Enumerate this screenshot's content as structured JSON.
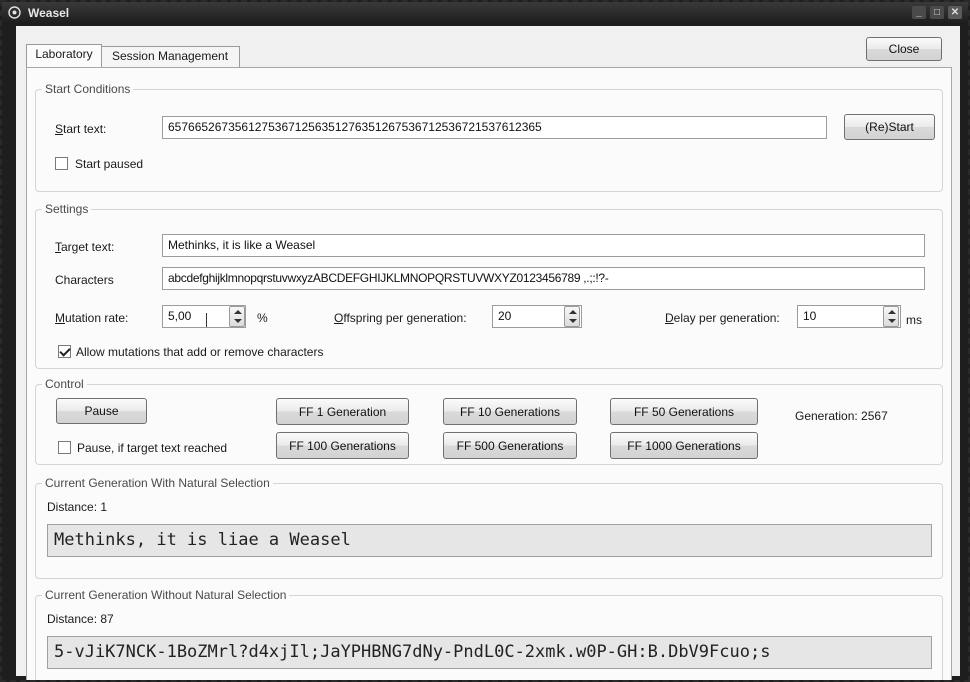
{
  "window": {
    "title": "Weasel",
    "close_label": "Close"
  },
  "tabs": [
    {
      "label": "Laboratory",
      "active": true
    },
    {
      "label": "Session Management",
      "active": false
    }
  ],
  "start_conditions": {
    "title": "Start Conditions",
    "start_text_label": "Start text:",
    "start_text_value": "65766526735612753671256351276351267536712536721537612365",
    "restart_label": "(Re)Start",
    "start_paused_label": "Start paused",
    "start_paused_checked": false
  },
  "settings": {
    "title": "Settings",
    "target_text_label": "Target text:",
    "target_text_value": "Methinks, it is like a Weasel",
    "characters_label": "Characters",
    "characters_value": "abcdefghijklmnopqrstuvwxyzABCDEFGHIJKLMNOPQRSTUVWXYZ0123456789 ,.;:!?-",
    "mutation_rate_label": "Mutation rate:",
    "mutation_rate_value": "5,00",
    "mutation_rate_unit": "%",
    "offspring_label": "Offspring per generation:",
    "offspring_value": "20",
    "delay_label": "Delay per generation:",
    "delay_value": "10",
    "delay_unit": "ms",
    "allow_mutations_label": "Allow mutations that add or remove characters",
    "allow_mutations_checked": true
  },
  "control": {
    "title": "Control",
    "pause_label": "Pause",
    "pause_if_reached_label": "Pause, if target text reached",
    "pause_if_reached_checked": false,
    "ff_buttons": [
      "FF 1 Generation",
      "FF 10 Generations",
      "FF 50 Generations",
      "FF 100 Generations",
      "FF 500 Generations",
      "FF 1000 Generations"
    ],
    "generation_text": "Generation: 2567"
  },
  "with_selection": {
    "title": "Current Generation With Natural Selection",
    "distance_text": "Distance: 1",
    "text": "Methinks, it is liae a Weasel"
  },
  "without_selection": {
    "title": "Current Generation Without Natural Selection",
    "distance_text": "Distance: 87",
    "text": "5-vJiK7NCK-1BoZMrl?d4xjIl;JaYPHBNG7dNy-PndL0C-2xmk.w0P-GH:B.DbV9Fcuo;s"
  }
}
